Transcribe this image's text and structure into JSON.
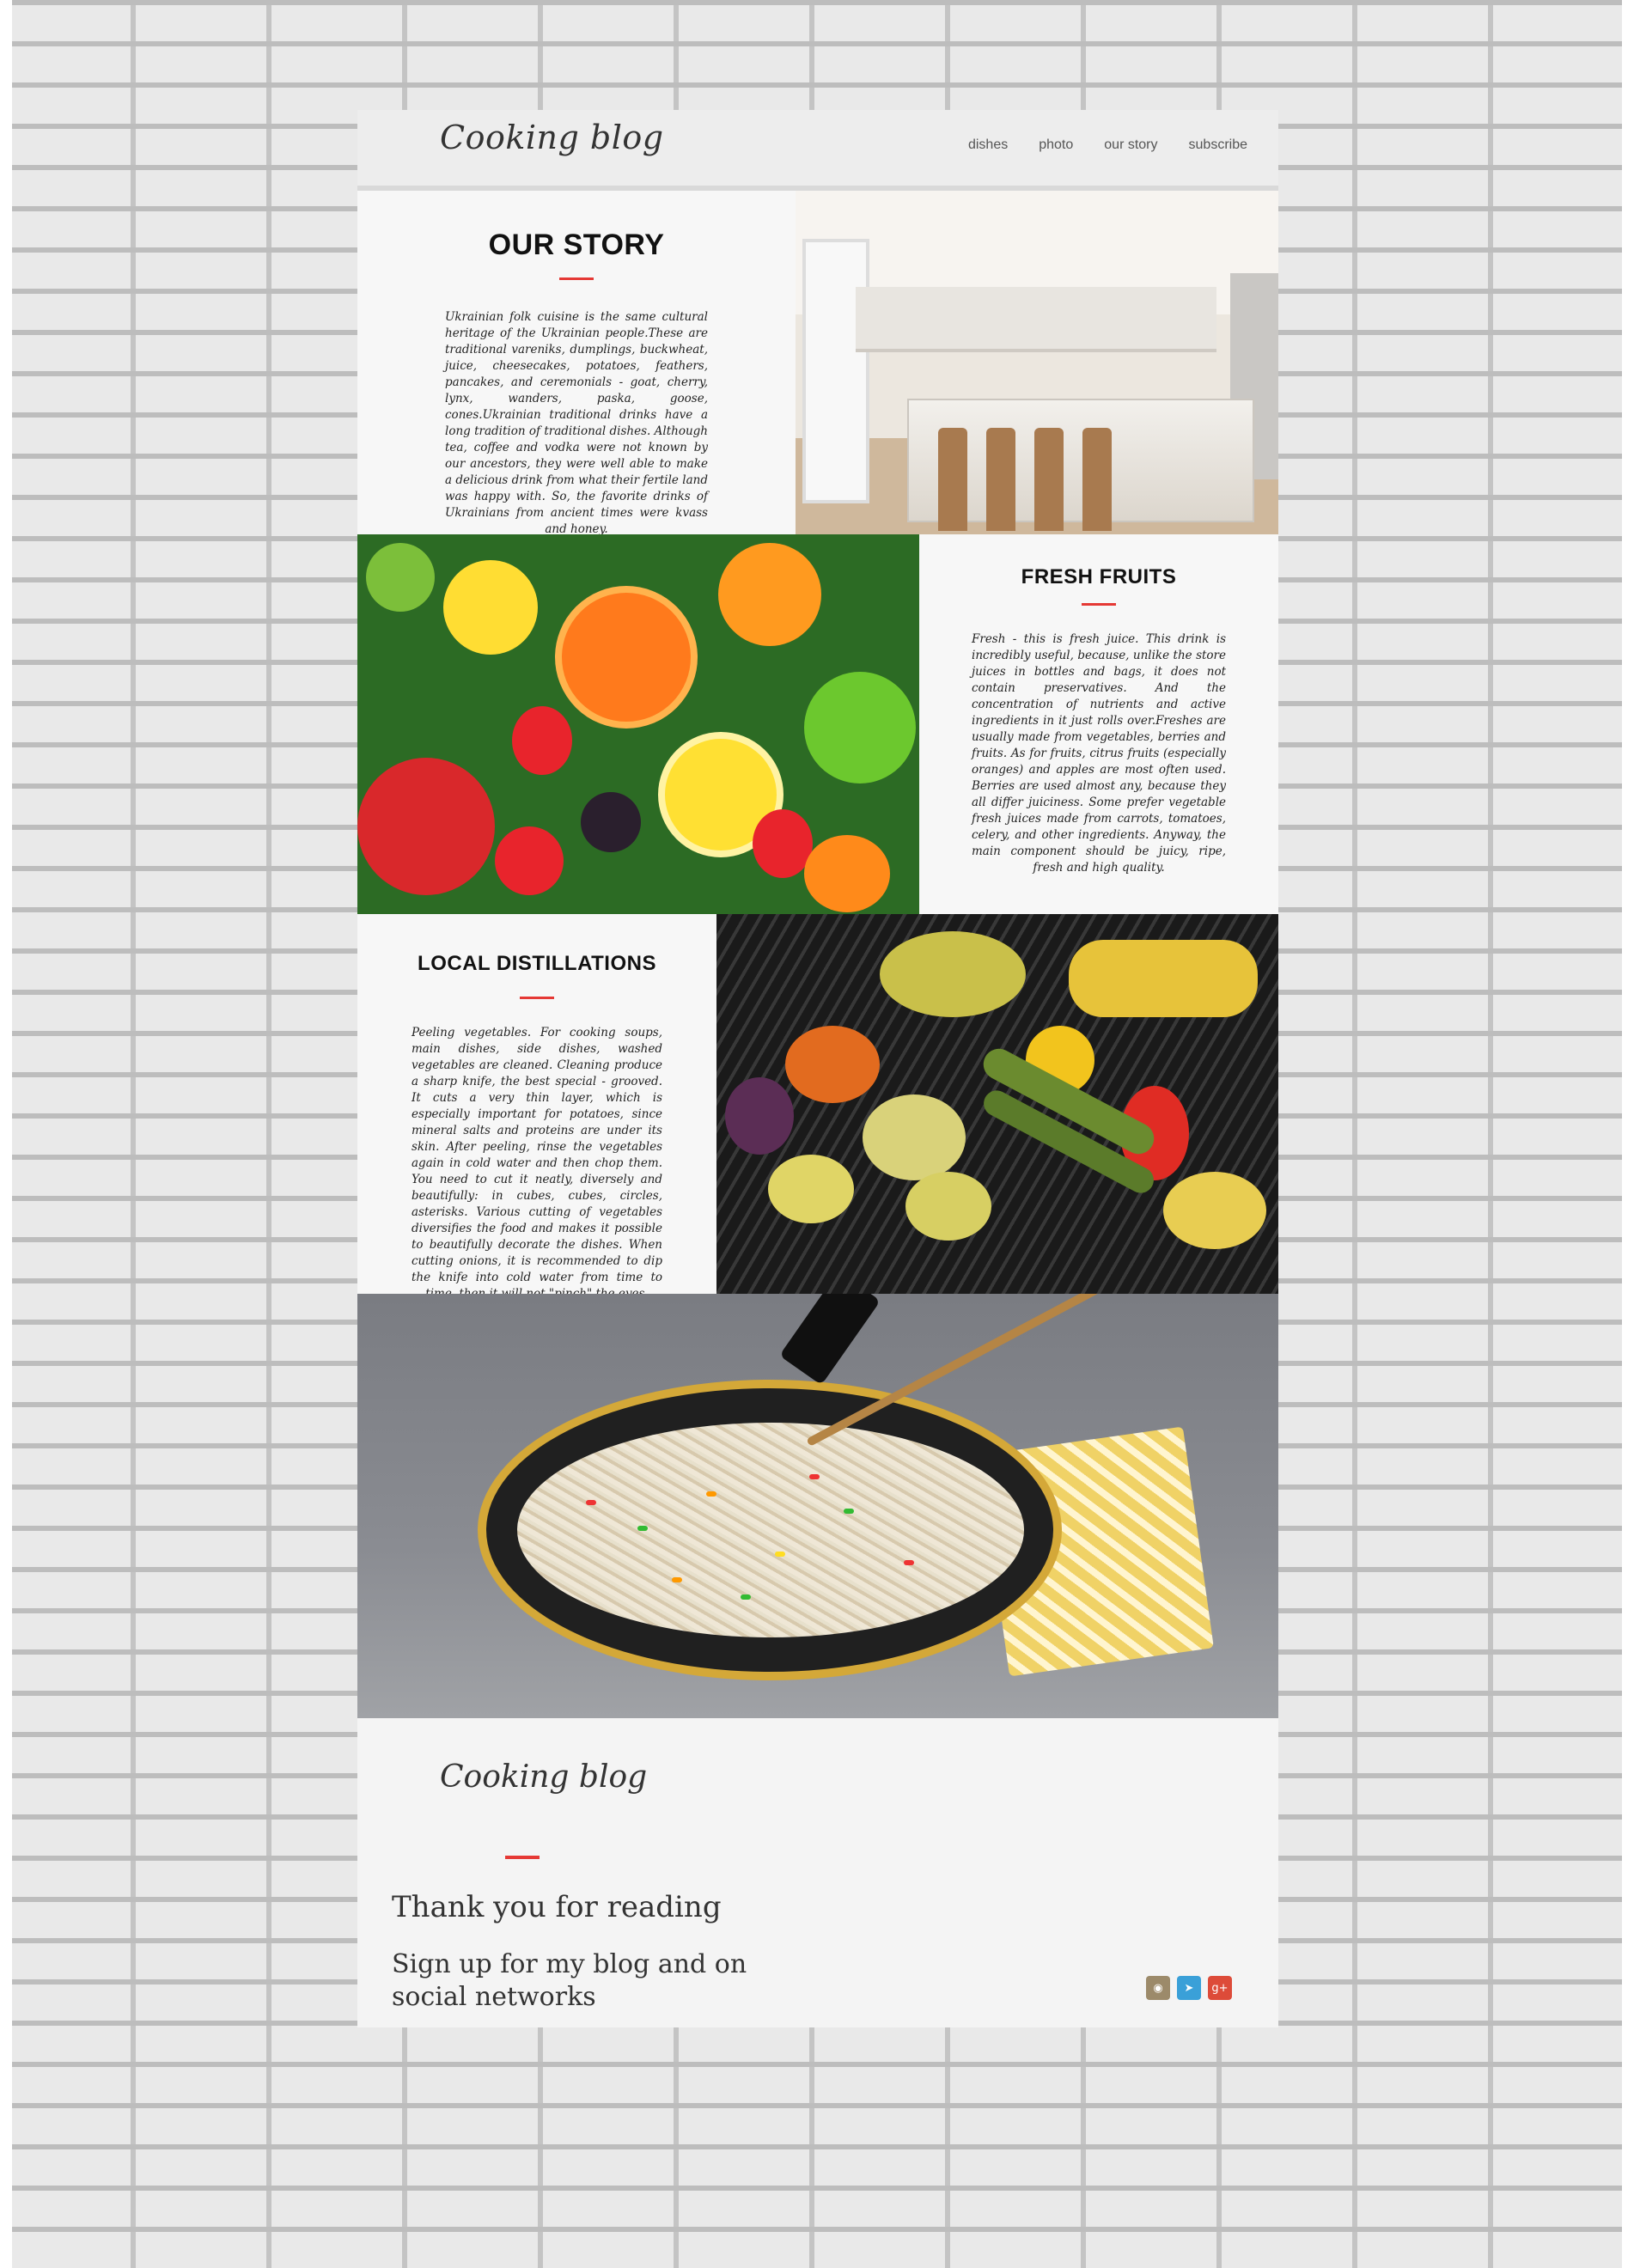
{
  "header": {
    "logo": "Cooking blog",
    "nav": [
      "dishes",
      "photo",
      "our story",
      "subscribe"
    ]
  },
  "sections": {
    "our_story": {
      "title": "OUR STORY",
      "text": "Ukrainian folk cuisine is the same cultural heritage of the Ukrainian people.These are traditional vareniks, dumplings, buckwheat, juice, cheesecakes, potatoes, feathers, pancakes, and ceremonials - goat, cherry, lynx, wanders, paska, goose, cones.Ukrainian traditional drinks have a long tradition of traditional dishes. Although tea, coffee and vodka were not known by our ancestors, they were well able to make a delicious drink from what their fertile land was happy with. So, the favorite drinks of Ukrainians from ancient times were kvass and honey."
    },
    "fresh_fruits": {
      "title": "FRESH FRUITS",
      "text": "Fresh - this is fresh juice. This drink is incredibly useful, because, unlike the store juices in bottles and bags, it does not contain preservatives. And the concentration of nutrients and active ingredients in it just rolls over.Freshes are usually made from vegetables, berries and fruits. As for fruits, citrus fruits (especially oranges) and apples are most often used. Berries are used almost any, because they all differ juiciness. Some prefer vegetable fresh juices made from carrots, tomatoes, celery, and other ingredients. Anyway, the main component should be juicy, ripe, fresh and high quality."
    },
    "local_distillations": {
      "title": "LOCAL DISTILLATIONS",
      "text": "Peeling vegetables. For cooking soups, main dishes, side dishes, washed vegetables are cleaned. Cleaning produce a sharp knife, the best special - grooved. It cuts a very thin layer, which is especially important for potatoes, since mineral salts and proteins are under its skin. After peeling, rinse the vegetables again in cold water and then chop them. You need to cut it neatly, diversely and beautifully: in cubes, cubes, circles, asterisks. Various cutting of vegetables diversifies the food and makes it possible to beautifully decorate the dishes. When cutting onions, it is recommended to dip the knife into cold water from time to time, then it will not \"pinch\" the eyes."
    }
  },
  "footer": {
    "logo": "Cooking blog",
    "thanks": "Thank you for reading",
    "signup": "Sign up for my blog and on social networks",
    "social": [
      {
        "icon": "instagram-icon",
        "glyph": "◉",
        "color": "#9c8a6a"
      },
      {
        "icon": "telegram-icon",
        "glyph": "➤",
        "color": "#3aa0d8"
      },
      {
        "icon": "google-plus-icon",
        "glyph": "g+",
        "color": "#dd4b39"
      }
    ]
  },
  "colors": {
    "accent": "#e53935"
  }
}
